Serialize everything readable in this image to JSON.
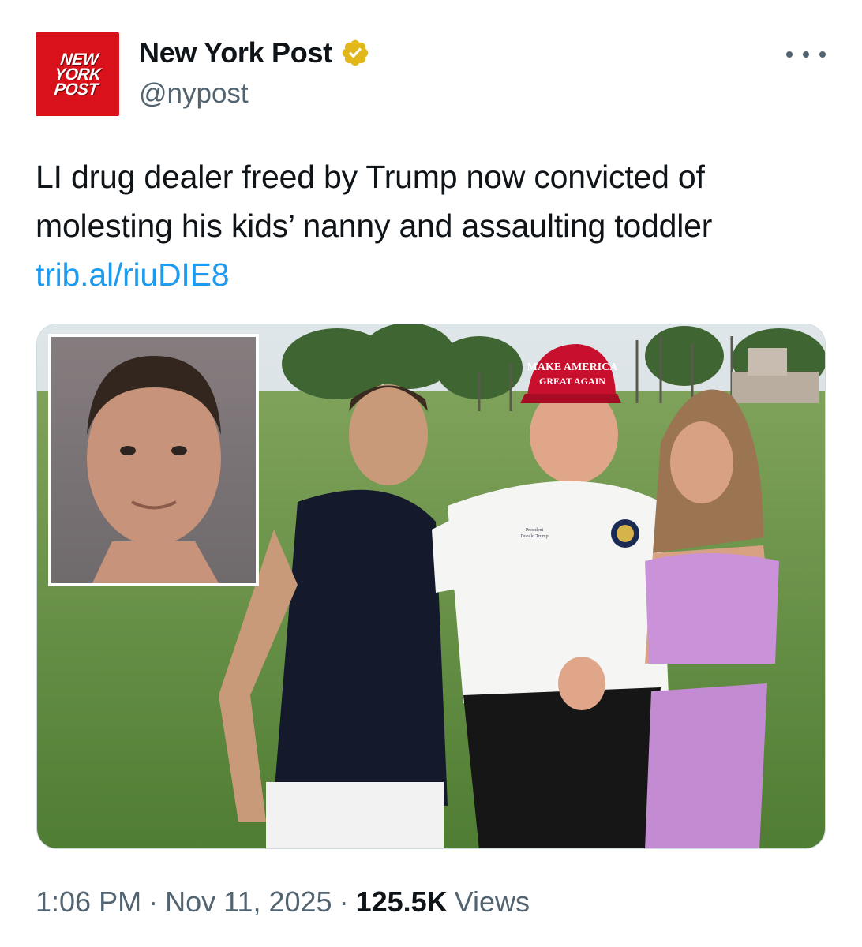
{
  "author": {
    "avatar_logo_lines": [
      "NEW",
      "YORK",
      "POST"
    ],
    "display_name": "New York Post",
    "handle": "@nypost",
    "verified_badge_color": "#e2b719",
    "avatar_color": "#d9111a"
  },
  "tweet": {
    "text": "LI drug dealer freed by Trump now convicted of molesting his kids’ nanny and assaulting toddler",
    "link": "trib.al/riuDIE8"
  },
  "media": {
    "hat_lines": [
      "MAKE AMERICA",
      "GREAT AGAIN"
    ],
    "shirt_lines": [
      "President",
      "Donald Trump"
    ]
  },
  "footer": {
    "time": "1:06 PM",
    "date": "Nov 11, 2025",
    "separator": "·",
    "views_count": "125.5K",
    "views_label": "Views"
  },
  "colors": {
    "link": "#1d9bf0",
    "secondary_text": "#536471",
    "primary_text": "#0f1419"
  }
}
